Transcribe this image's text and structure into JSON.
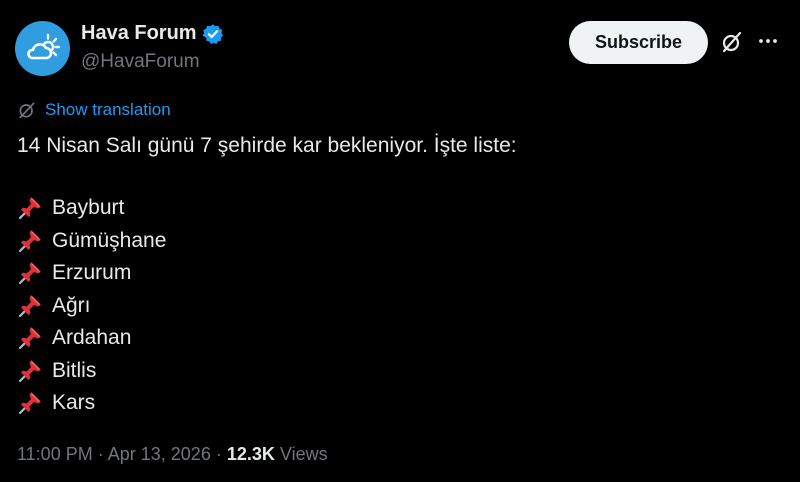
{
  "author": {
    "name": "Hava Forum",
    "handle": "@HavaForum",
    "verified": true,
    "avatar_color": "#2f9de0"
  },
  "actions": {
    "subscribe_label": "Subscribe",
    "grok_icon": "grok-slash-circle-icon",
    "more_icon": "more-dots-icon"
  },
  "translation": {
    "link_label": "Show translation",
    "icon": "translate-icon"
  },
  "tweet": {
    "text": "14 Nisan Salı günü 7 şehirde kar bekleniyor. İşte liste:",
    "list_icon": "pushpin-icon",
    "list": [
      "Bayburt",
      "Gümüşhane",
      "Erzurum",
      "Ağrı",
      "Ardahan",
      "Bitlis",
      "Kars"
    ]
  },
  "meta": {
    "time": "11:00 PM",
    "separator": "·",
    "date": "Apr 13, 2026",
    "views_count": "12.3K",
    "views_label": "Views"
  },
  "colors": {
    "background": "#000000",
    "text": "#e7e9ea",
    "secondary": "#71767b",
    "link": "#1d9bf0",
    "verified": "#1d9bf0",
    "pin": "#e0303a"
  }
}
